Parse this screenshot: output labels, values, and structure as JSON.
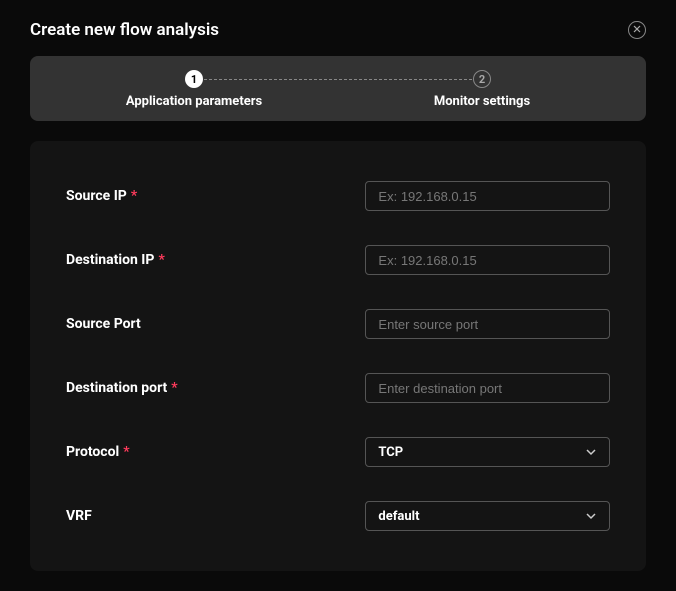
{
  "dialog": {
    "title": "Create new flow analysis"
  },
  "stepper": {
    "step1": {
      "number": "1",
      "label": "Application parameters"
    },
    "step2": {
      "number": "2",
      "label": "Monitor settings"
    }
  },
  "form": {
    "sourceIp": {
      "label": "Source IP",
      "placeholder": "Ex: 192.168.0.15"
    },
    "destIp": {
      "label": "Destination IP",
      "placeholder": "Ex: 192.168.0.15"
    },
    "sourcePort": {
      "label": "Source Port",
      "placeholder": "Enter source port"
    },
    "destPort": {
      "label": "Destination port",
      "placeholder": "Enter destination port"
    },
    "protocol": {
      "label": "Protocol",
      "value": "TCP"
    },
    "vrf": {
      "label": "VRF",
      "value": "default"
    },
    "requiredMark": "*"
  }
}
